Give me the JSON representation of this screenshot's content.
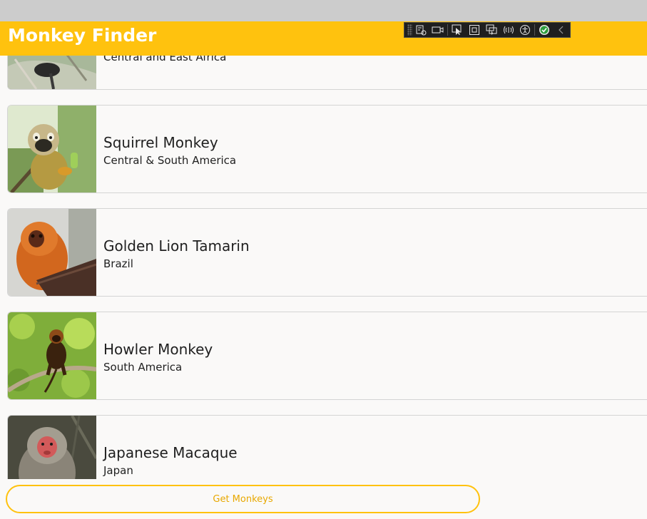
{
  "app": {
    "title": "Monkey Finder"
  },
  "dev_toolbar": {
    "icons": [
      "live-visual-tree-icon",
      "record-icon",
      "select-element-icon",
      "display-layout-adorners-icon",
      "track-focus-icon",
      "binding-failures-icon",
      "accessibility-icon",
      "no-issues-check-icon",
      "collapse-toolbar-icon"
    ]
  },
  "monkeys": [
    {
      "name": "",
      "location": "Central and East Africa"
    },
    {
      "name": "Squirrel Monkey",
      "location": "Central & South America"
    },
    {
      "name": "Golden Lion Tamarin",
      "location": "Brazil"
    },
    {
      "name": "Howler Monkey",
      "location": "South America"
    },
    {
      "name": "Japanese Macaque",
      "location": "Japan"
    }
  ],
  "actions": {
    "get_monkeys_label": "Get Monkeys"
  },
  "colors": {
    "accent": "#ffc20e",
    "titlebar": "#cccccc",
    "background": "#faf9f8",
    "button_text": "#e8a800"
  }
}
